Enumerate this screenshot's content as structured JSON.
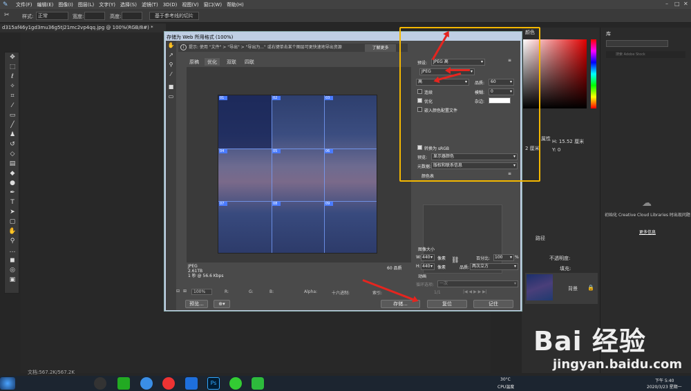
{
  "menubar": {
    "items": [
      "文件(F)",
      "编辑(E)",
      "图像(I)",
      "图层(L)",
      "文字(Y)",
      "选择(S)",
      "滤镜(T)",
      "3D(D)",
      "视图(V)",
      "窗口(W)",
      "帮助(H)"
    ]
  },
  "optbar": {
    "style_label": "样式:",
    "style_value": "正常",
    "width_label": "宽度:",
    "height_label": "高度:",
    "slice_btn": "基于参考线的切片"
  },
  "doc_tab": "d315af46y1gd3mu36g5tj21mc2vp4qq.jpg @ 100%(RGB/8#) *",
  "status": "文档:567.2K/567.2K",
  "dialog": {
    "title": "存储为 Web 所用格式 (100%)",
    "hint": "提示: 使用 \"文件\" > \"导出\" > \"导出为...\" 或右键单击某个图层可更快速地导出资源",
    "learn_more": "了解更多",
    "tabs": [
      "原稿",
      "优化",
      "双联",
      "四联"
    ],
    "slices": [
      "01",
      "02",
      "03",
      "04",
      "05",
      "06",
      "07",
      "08",
      "09"
    ],
    "info": {
      "format": "JPEG",
      "size": "2.61TB",
      "time": "1 秒 @ 56.6 Kbps",
      "quality": "60 品质"
    },
    "bottom": {
      "zoom": "100%",
      "r": "R:",
      "g": "G:",
      "b": "B:",
      "alpha": "Alpha:",
      "hex": "十六进制:",
      "index": "索引:"
    },
    "buttons": {
      "preview": "预览...",
      "save": "存储...",
      "reset": "复位",
      "remember": "记住"
    },
    "settings": {
      "preset_label": "预设:",
      "preset_value": "JPEG 高",
      "format_value": "JPEG",
      "quality_level": "高",
      "quality_label": "品质:",
      "quality_value": "60",
      "progressive": "连续",
      "blur_label": "模糊:",
      "blur_value": "0",
      "optimized": "优化",
      "matte_label": "杂边:",
      "embed_profile": "嵌入颜色配置文件",
      "convert_srgb": "转换为 sRGB",
      "preview_label": "预览:",
      "preview_value": "显示器颜色",
      "metadata_label": "元数据:",
      "metadata_value": "版权和联系信息",
      "color_table": "颜色表",
      "image_size": "图像大小",
      "w_label": "W:",
      "w_value": "440",
      "h_label": "H:",
      "h_value": "440",
      "unit": "像素",
      "percent_label": "百分比:",
      "percent_value": "100",
      "percent_unit": "%",
      "quality2_label": "品质:",
      "quality2_value": "两次立方",
      "animation": "动画",
      "loop_label": "循环选项:",
      "loop_value": "一次",
      "frame": "1/1"
    }
  },
  "right_panels": {
    "color_tab": "颜色",
    "lib_tab": "库",
    "search_placeholder": "搜索 Adobe Stock",
    "props_tab": "属性",
    "h_text": "H: 15.52 厘米",
    "w_text": "2 厘米",
    "y_text": "Y: 0",
    "lib_msg": "初始化 Creative Cloud Libraries 时出现问题",
    "lib_more": "更多信息",
    "layers_tab": "路径",
    "opacity_label": "不透明度:",
    "fill_label": "填充:",
    "layer_name": "背景"
  },
  "taskbar": {
    "temp": "30°C",
    "cpu": "CPU温度",
    "time": "下午 5:40",
    "date": "2020/3/23 星期一"
  },
  "watermark": {
    "logo": "Bai 经验",
    "url": "jingyan.baidu.com"
  }
}
